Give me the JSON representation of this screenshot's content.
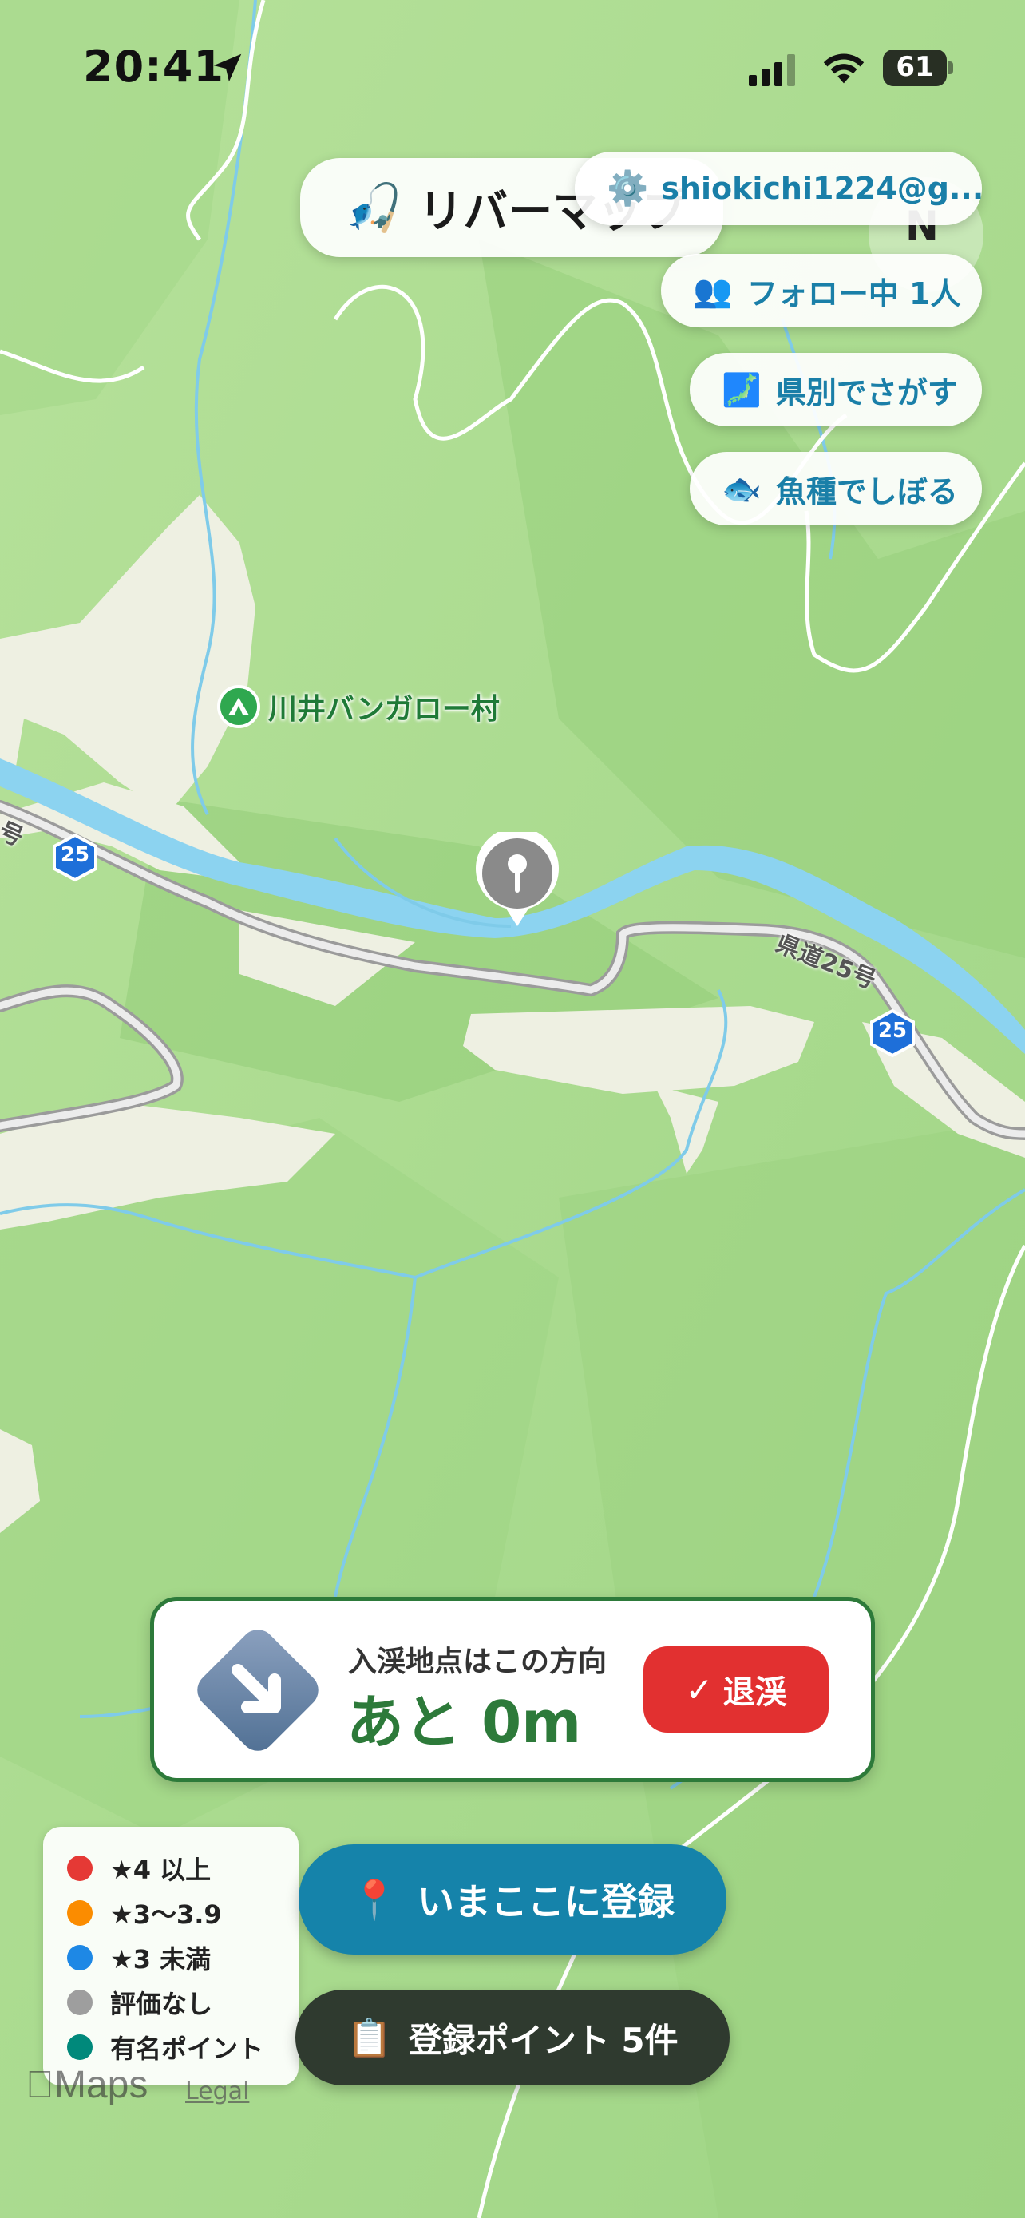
{
  "status_bar": {
    "time": "20:41",
    "battery": "61"
  },
  "header": {
    "title_emoji": "🎣",
    "title": "リバーマップ",
    "user_emoji": "⚙️",
    "user_label": "shiokichi1224@g..."
  },
  "compass": {
    "label": "N"
  },
  "side_buttons": {
    "follow": {
      "emoji": "👥",
      "label": "フォロー中 1人"
    },
    "prefecture": {
      "emoji": "🗾",
      "label": "県別でさがす"
    },
    "fish": {
      "emoji": "🐟",
      "label": "魚種でしぼる"
    }
  },
  "map": {
    "poi_label": "川井バンガロー村",
    "road_label_1": "県道25号",
    "road_label_2": "号",
    "route_number": "25",
    "logo": "Maps",
    "legal": "Legal"
  },
  "direction_card": {
    "caption": "入渓地点はこの方向",
    "distance": "あと 0m",
    "exit_label": "退渓",
    "exit_icon": "✓"
  },
  "legend": {
    "items": [
      {
        "label": "★4 以上",
        "color": "#e53935"
      },
      {
        "label": "★3～3.9",
        "color": "#fb8c00"
      },
      {
        "label": "★3 未満",
        "color": "#1e88e5"
      },
      {
        "label": "評価なし",
        "color": "#9e9e9e"
      },
      {
        "label": "有名ポイント",
        "color": "#00897b"
      }
    ]
  },
  "actions": {
    "register_emoji": "📍",
    "register_label": "いまここに登録",
    "points_emoji": "📋",
    "points_label": "登録ポイント 5件"
  },
  "icons": {
    "location_arrow": "location-arrow-icon",
    "direction": "direction-arrow-icon",
    "pin": "map-pin-icon",
    "camp": "camp-icon"
  }
}
